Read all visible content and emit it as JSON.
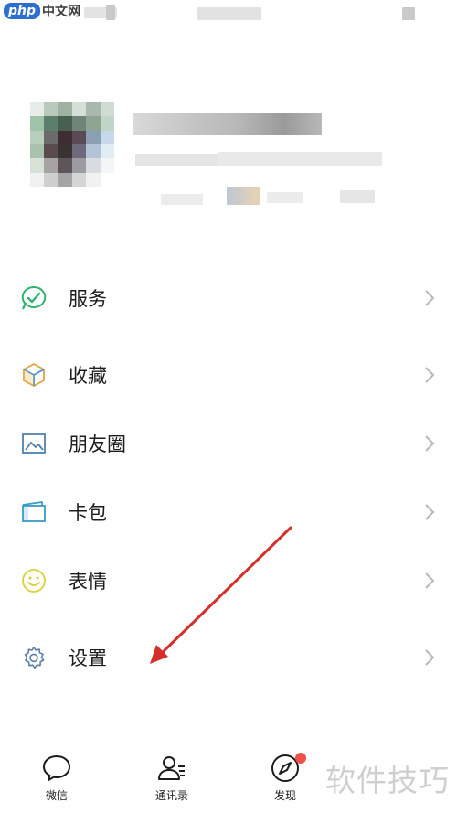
{
  "watermark": {
    "brand": "php",
    "cn": "中文网",
    "corner": "软件技巧"
  },
  "menu": [
    {
      "label": "服务",
      "icon": "service-icon"
    },
    {
      "label": "收藏",
      "icon": "favorites-icon"
    },
    {
      "label": "朋友圈",
      "icon": "moments-icon"
    },
    {
      "label": "卡包",
      "icon": "card-wallet-icon"
    },
    {
      "label": "表情",
      "icon": "sticker-icon"
    },
    {
      "label": "设置",
      "icon": "settings-icon"
    }
  ],
  "tabs": [
    {
      "label": "微信",
      "icon": "chat-icon"
    },
    {
      "label": "通讯录",
      "icon": "contacts-icon"
    },
    {
      "label": "发现",
      "icon": "discover-icon",
      "badge": true
    }
  ],
  "colors": {
    "accent_green": "#2fb36c",
    "arrow_red": "#d4302b",
    "badge_red": "#f0504c"
  }
}
